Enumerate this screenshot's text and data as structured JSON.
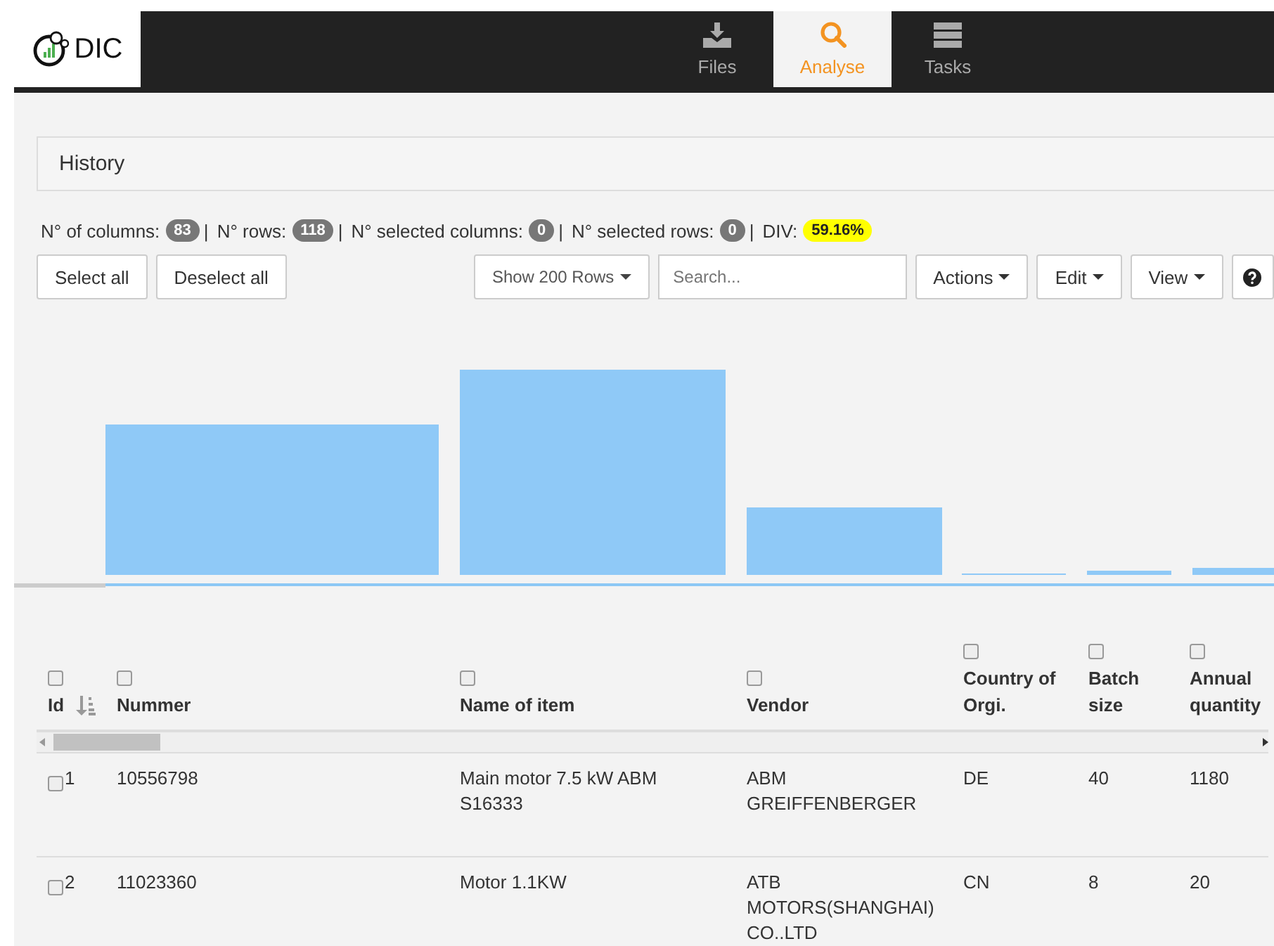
{
  "app": {
    "name": "DIC"
  },
  "nav": [
    {
      "label": "Files",
      "selected": false
    },
    {
      "label": "Analyse",
      "selected": true
    },
    {
      "label": "Tasks",
      "selected": false
    }
  ],
  "panel": {
    "title": "History"
  },
  "stats": [
    {
      "label": "N° of columns:",
      "value": "83",
      "kind": "count"
    },
    {
      "separator": "|",
      "label": "N° rows:",
      "value": "118",
      "kind": "count"
    },
    {
      "separator": "|",
      "label": "N° selected columns:",
      "value": "0",
      "kind": "count"
    },
    {
      "separator": "|",
      "label": "N° selected rows:",
      "value": "0",
      "kind": "count"
    },
    {
      "separator": "|",
      "label": "DIV:",
      "value": "59.16%",
      "kind": "highlight"
    }
  ],
  "toolbar": {
    "left_buttons": [
      "Select all",
      "Deselect all"
    ],
    "page_size": "Show 200 Rows",
    "search": {
      "placeholder": "Search..."
    },
    "menus": [
      "Actions",
      "Edit",
      "View"
    ]
  },
  "table": {
    "columns": [
      {
        "label": "Id",
        "checked": false,
        "sortable": true
      },
      {
        "label": "Nummer",
        "checked": false,
        "sortable": false
      },
      {
        "label": "Name of item",
        "checked": false,
        "sortable": false
      },
      {
        "label": "Vendor",
        "checked": false,
        "sortable": false
      },
      {
        "label": "Country of Orgi.",
        "checked": false,
        "sortable": false
      },
      {
        "label": "Batch size",
        "checked": false,
        "sortable": false
      },
      {
        "label": "Annual quantity",
        "checked": false,
        "sortable": false
      }
    ],
    "rows": [
      {
        "checked": false,
        "cells": [
          "1",
          "10556798",
          "Main motor 7.5 kW ABM S16333",
          "ABM GREIFFENBERGER",
          "DE",
          "40",
          "1180"
        ]
      },
      {
        "checked": false,
        "cells": [
          "2",
          "11023360",
          "Motor 1.1KW",
          "ATB MOTORS(SHANGHAI) CO..LTD",
          "CN",
          "8",
          "20"
        ]
      }
    ]
  }
}
